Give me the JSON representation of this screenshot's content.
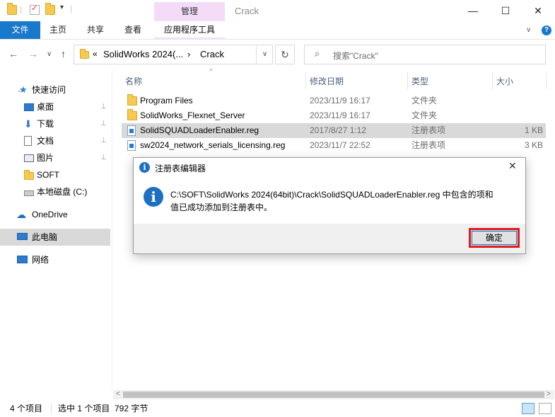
{
  "window": {
    "title": "Crack",
    "manage_tab": "管理",
    "minimize": "—",
    "maximize": "☐",
    "close": "✕"
  },
  "ribbon": {
    "tabs": [
      "文件",
      "主页",
      "共享",
      "查看",
      "应用程序工具"
    ],
    "expand": "∨",
    "help": "?"
  },
  "nav": {
    "back": "←",
    "forward": "→",
    "recent": "∨",
    "up": "↑",
    "refresh": "↻",
    "breadcrumb_overflow": "«",
    "breadcrumb_parent": "SolidWorks 2024(...",
    "breadcrumb_sep": "›",
    "breadcrumb_current": "Crack",
    "dropdown": "∨",
    "search_placeholder": "搜索\"Crack\""
  },
  "sidebar": {
    "quick_access": "快速访问",
    "items": [
      {
        "label": "桌面",
        "icon": "desktop-icon",
        "pinned": true
      },
      {
        "label": "下载",
        "icon": "download-icon",
        "pinned": true
      },
      {
        "label": "文档",
        "icon": "document-icon",
        "pinned": true
      },
      {
        "label": "图片",
        "icon": "pictures-icon",
        "pinned": true
      },
      {
        "label": "SOFT",
        "icon": "folder-icon",
        "pinned": false
      },
      {
        "label": "本地磁盘 (C:)",
        "icon": "drive-icon",
        "pinned": false
      }
    ],
    "onedrive": "OneDrive",
    "this_pc": "此电脑",
    "network": "网络",
    "pin_glyph": "📌"
  },
  "columns": {
    "name": "名称",
    "date": "修改日期",
    "type": "类型",
    "size": "大小",
    "sort_glyph": "^"
  },
  "files": [
    {
      "name": "Program Files",
      "date": "2023/11/9 16:17",
      "type": "文件夹",
      "size": "",
      "kind": "folder"
    },
    {
      "name": "SolidWorks_Flexnet_Server",
      "date": "2023/11/9 16:17",
      "type": "文件夹",
      "size": "",
      "kind": "folder"
    },
    {
      "name": "SolidSQUADLoaderEnabler.reg",
      "date": "2017/8/27 1:12",
      "type": "注册表项",
      "size": "1 KB",
      "kind": "reg",
      "selected": true
    },
    {
      "name": "sw2024_network_serials_licensing.reg",
      "date": "2023/11/7 22:52",
      "type": "注册表项",
      "size": "3 KB",
      "kind": "reg"
    }
  ],
  "dialog": {
    "title": "注册表编辑器",
    "close": "✕",
    "icon": "i",
    "message_line1": "C:\\SOFT\\SolidWorks 2024(64bit)\\Crack\\SolidSQUADLoaderEnabler.reg 中包含的项和",
    "message_line2": "值已成功添加到注册表中。",
    "ok": "确定"
  },
  "scrollbar": {
    "left": "<",
    "right": ">"
  },
  "status": {
    "count": "4 个项目",
    "selection": "选中 1 个项目  792 字节"
  },
  "colors": {
    "accent": "#1979ca",
    "manage_tab": "#f4dcf9",
    "highlight_red": "#e21b1b",
    "selected_row": "#d9d9d9"
  }
}
